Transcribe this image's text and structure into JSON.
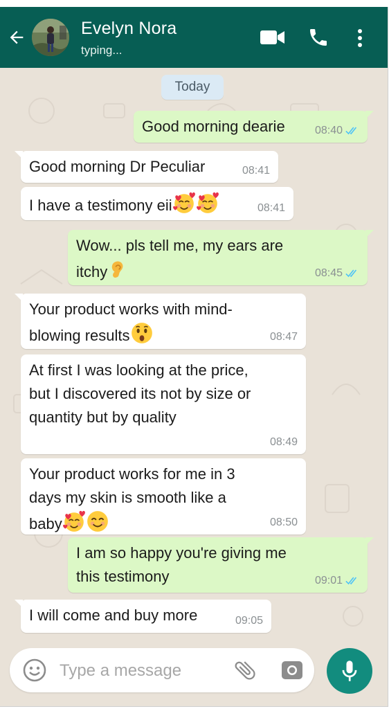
{
  "header": {
    "contact_name": "Evelyn Nora",
    "status": "typing...",
    "icons": [
      "back-arrow-icon",
      "video-call-icon",
      "phone-call-icon",
      "more-options-icon"
    ]
  },
  "date_divider": "Today",
  "messages": [
    {
      "direction": "out",
      "text": "Good morning dearie",
      "time": "08:40",
      "read": true
    },
    {
      "direction": "in",
      "text": "Good morning Dr Peculiar",
      "time": "08:41"
    },
    {
      "direction": "in",
      "text": "I have a testimony eii",
      "emojis": [
        "smiling-face-with-hearts",
        "smiling-face-with-hearts"
      ],
      "time": "08:41"
    },
    {
      "direction": "out",
      "text": "Wow... pls tell me, my ears are itchy",
      "emojis": [
        "ear"
      ],
      "time": "08:45",
      "read": true
    },
    {
      "direction": "in",
      "text": "Your product works with mind-blowing results",
      "emojis": [
        "astonished-face"
      ],
      "time": "08:47"
    },
    {
      "direction": "in",
      "text": "At first I was looking at the price, but I discovered its not by size or quantity but by quality",
      "time": "08:49"
    },
    {
      "direction": "in",
      "text": "Your product works for me in 3 days my skin is smooth like a baby",
      "emojis": [
        "smiling-face-with-hearts",
        "smiling-face"
      ],
      "time": "08:50"
    },
    {
      "direction": "out",
      "text": "I am so happy you're giving me this testimony",
      "time": "09:01",
      "read": true
    },
    {
      "direction": "in",
      "text": "I will come and buy more",
      "time": "09:05"
    }
  ],
  "composer": {
    "placeholder": "Type a message",
    "value": "",
    "icons": [
      "emoji-icon",
      "attach-icon",
      "camera-icon",
      "mic-icon"
    ]
  },
  "colors": {
    "header": "#075e54",
    "outgoing_bubble": "#dcf8c6",
    "incoming_bubble": "#ffffff",
    "chat_background": "#e9e2d8",
    "read_ticks": "#4fc3f7",
    "mic_button": "#128c7e"
  }
}
